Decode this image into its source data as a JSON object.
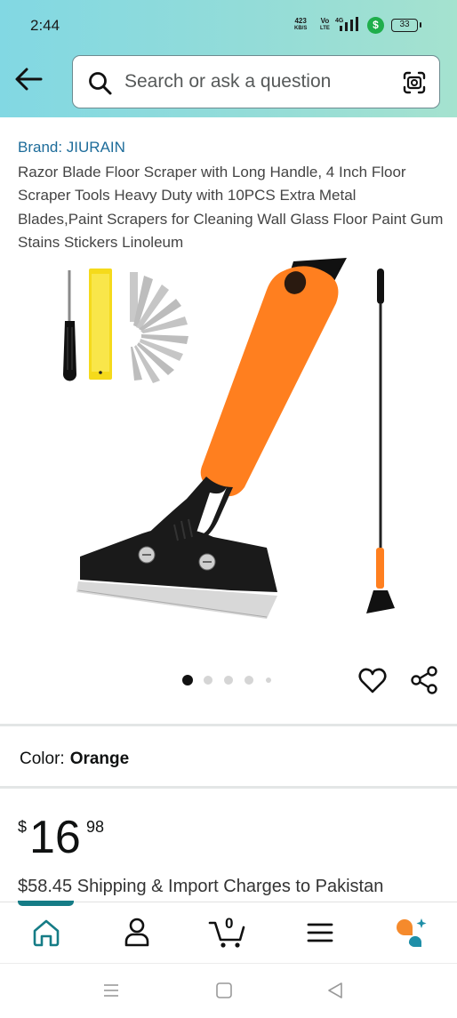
{
  "status_bar": {
    "time": "2:44",
    "net_speed": "423",
    "net_unit": "KB/S",
    "volte_top": "Vo",
    "volte_bottom": "LTE",
    "network": "4G",
    "battery": "33"
  },
  "search": {
    "placeholder": "Search or ask a question"
  },
  "product": {
    "brand": "Brand: JIURAIN",
    "title": "Razor Blade Floor Scraper with Long Handle, 4 Inch Floor Scraper Tools Heavy Duty with 10PCS Extra Metal Blades,Paint Scrapers for Cleaning Wall Glass Floor Paint Gum Stains Stickers Linoleum",
    "image_count": 5,
    "active_image": 1,
    "color_label": "Color:",
    "color_value": "Orange",
    "price_symbol": "$",
    "price_whole": "16",
    "price_fraction": "98",
    "shipping": "$58.45 Shipping & Import Charges to Pakistan"
  },
  "bottom_nav": {
    "items": [
      "home",
      "account",
      "cart",
      "menu",
      "rufus"
    ],
    "active": "home",
    "cart_count": "0"
  },
  "colors": {
    "header_start": "#82d8e3",
    "header_end": "#a5e2cf",
    "brand_link": "#1d6c9a",
    "active_tab": "#157c86",
    "handle_orange": "#ff7f1f",
    "rufus_orange": "#f58a2c"
  }
}
